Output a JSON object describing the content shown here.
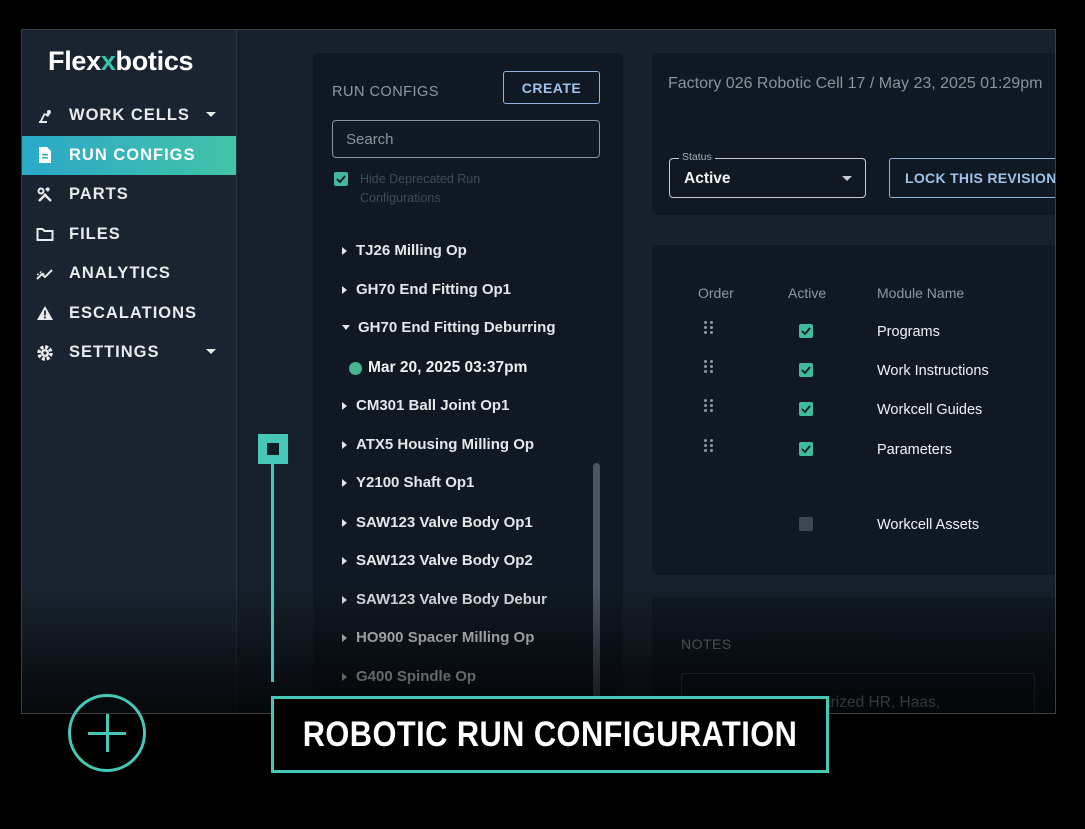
{
  "app": {
    "logo_prefix": "Flex",
    "logo_accent": "x",
    "logo_suffix": "botics"
  },
  "nav": {
    "items": [
      {
        "label": "WORK CELLS",
        "icon": "robot-arm-icon"
      },
      {
        "label": "RUN CONFIGS",
        "icon": "document-icon",
        "active": true
      },
      {
        "label": "PARTS",
        "icon": "tools-icon"
      },
      {
        "label": "FILES",
        "icon": "folder-icon"
      },
      {
        "label": "ANALYTICS",
        "icon": "analytics-icon"
      },
      {
        "label": "ESCALATIONS",
        "icon": "warning-icon"
      },
      {
        "label": "SETTINGS",
        "icon": "gear-icon"
      }
    ]
  },
  "run_configs": {
    "title": "RUN CONFIGS",
    "create_label": "CREATE",
    "search_placeholder": "Search",
    "hide_deprecated_label": "Hide Deprecated Run Configurations",
    "items": [
      "TJ26 Milling Op",
      "GH70 End Fitting Op1",
      "GH70 End Fitting Deburring",
      "CM301 Ball Joint Op1",
      "ATX5 Housing Milling Op",
      "Y2100 Shaft Op1",
      "SAW123 Valve Body Op1",
      "SAW123 Valve Body Op2",
      "SAW123 Valve Body Debur",
      "HO900 Spacer Milling Op",
      "G400 Spindle Op"
    ],
    "expanded_revision": "Mar 20, 2025 03:37pm"
  },
  "header": {
    "breadcrumb": "Factory 026 Robotic Cell 17 / May 23, 2025 01:29pm",
    "status_label": "Status",
    "status_value": "Active",
    "lock_label": "LOCK THIS REVISION"
  },
  "modules": {
    "headers": {
      "order": "Order",
      "active": "Active",
      "name": "Module Name"
    },
    "rows": [
      {
        "name": "Programs",
        "active": true
      },
      {
        "name": "Work Instructions",
        "active": true
      },
      {
        "name": "Workcell Guides",
        "active": true
      },
      {
        "name": "Parameters",
        "active": true
      },
      {
        "name": "Workcell Assets",
        "active": false
      }
    ]
  },
  "notes": {
    "title": "NOTES",
    "text": "arized HR, Haas,"
  },
  "caption": "ROBOTIC RUN CONFIGURATION",
  "colors": {
    "accent": "#45c9b6",
    "active_nav_start": "#2aa8c8",
    "active_nav_end": "#43c3a7",
    "check": "#41b99d"
  }
}
